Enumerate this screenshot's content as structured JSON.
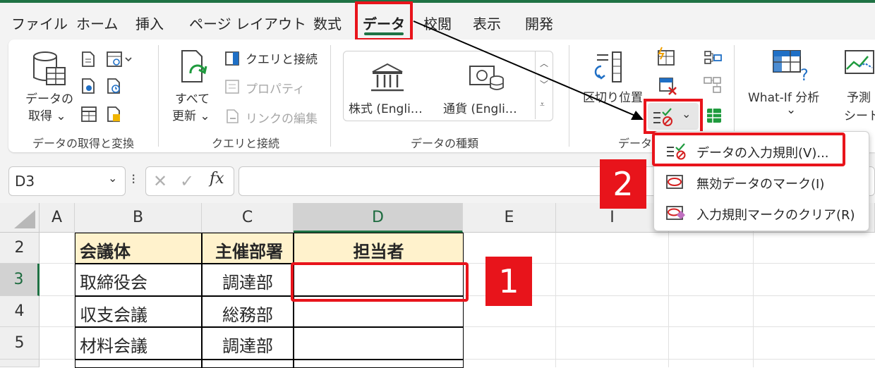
{
  "menu": {
    "tabs": [
      {
        "label": "ファイル"
      },
      {
        "label": "ホーム"
      },
      {
        "label": "挿入"
      },
      {
        "label": "ページ レイアウト"
      },
      {
        "label": "数式"
      },
      {
        "label": "データ"
      },
      {
        "label": "校閲"
      },
      {
        "label": "表示"
      },
      {
        "label": "開発"
      }
    ],
    "active_tab": "データ"
  },
  "ribbon": {
    "get_data": {
      "line1": "データの",
      "line2": "取得",
      "chev": "⌄"
    },
    "refresh_all": {
      "line1": "すべて",
      "line2": "更新",
      "chev": "⌄"
    },
    "queries": {
      "connections": "クエリと接続",
      "properties": "プロパティ",
      "edit_links": "リンクの編集"
    },
    "data_types": {
      "stocks": "株式 (Engli…",
      "currency": "通貨 (Engli…"
    },
    "text_to_columns": "区切り位置",
    "what_if": {
      "label": "What-If 分析",
      "chev": "⌄"
    },
    "forecast": {
      "line1": "予測",
      "line2": "シート"
    },
    "group_labels": {
      "get_transform": "データの取得と変換",
      "queries_connections": "クエリと接続",
      "data_types": "データの種類",
      "data_tools": "データ"
    }
  },
  "formula_bar": {
    "name_box": "D3",
    "fx": "fx",
    "cancel": "✕",
    "enter": "✓",
    "value": ""
  },
  "grid": {
    "columns": [
      "A",
      "B",
      "C",
      "D",
      "E",
      "I"
    ],
    "selected_column": "D",
    "rows": [
      {
        "num": "2",
        "B": "会議体",
        "C": "主催部署",
        "D": "担当者"
      },
      {
        "num": "3",
        "B": "取締役会",
        "C": "調達部",
        "D": ""
      },
      {
        "num": "4",
        "B": "収支会議",
        "C": "総務部",
        "D": ""
      },
      {
        "num": "5",
        "B": "材料会議",
        "C": "調達部",
        "D": ""
      }
    ],
    "selected_row": "3",
    "active_cell": "D3"
  },
  "validation_menu": {
    "items": [
      {
        "label": "データの入力規則(V)..."
      },
      {
        "label": "無効データのマーク(I)"
      },
      {
        "label": "入力規則マークのクリア(R)"
      }
    ]
  },
  "callouts": {
    "step1": "1",
    "step2": "2"
  },
  "colors": {
    "excel_green": "#1f7244",
    "highlight_red": "#e8141b",
    "header_fill": "#fff2cc"
  }
}
